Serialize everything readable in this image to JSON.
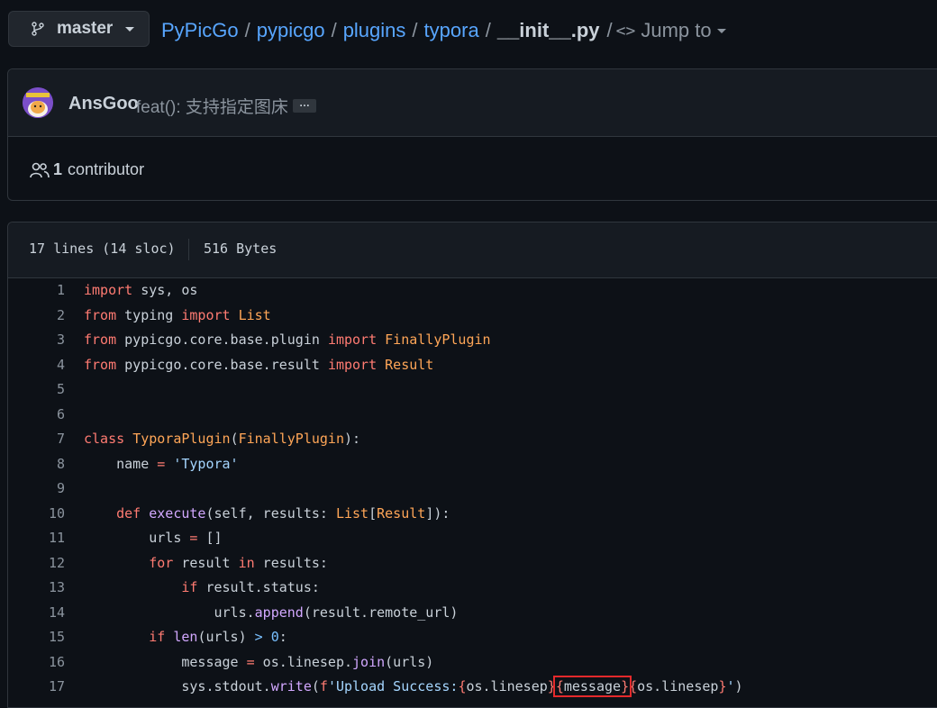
{
  "branch": {
    "name": "master"
  },
  "breadcrumb": {
    "repo": "PyPicGo",
    "parts": [
      "pypicgo",
      "plugins",
      "typora"
    ],
    "file": "__init__.py",
    "jump_label": "Jump to"
  },
  "commit": {
    "author": "AnsGoo",
    "message": "feat(): 支持指定图床",
    "ellipsis": "…"
  },
  "contributors": {
    "count": "1",
    "label": "contributor"
  },
  "file_info": {
    "lines": "17 lines (14 sloc)",
    "size": "516 Bytes"
  },
  "code": {
    "line_numbers": [
      "1",
      "2",
      "3",
      "4",
      "5",
      "6",
      "7",
      "8",
      "9",
      "10",
      "11",
      "12",
      "13",
      "14",
      "15",
      "16",
      "17"
    ],
    "highlighted_token": "message"
  },
  "colors": {
    "background": "#0d1117",
    "link": "#58a6ff",
    "keyword": "#ff7b72",
    "class": "#ffa657",
    "function": "#d2a8ff",
    "string": "#a5d6ff",
    "highlight_box": "#e5292b"
  }
}
